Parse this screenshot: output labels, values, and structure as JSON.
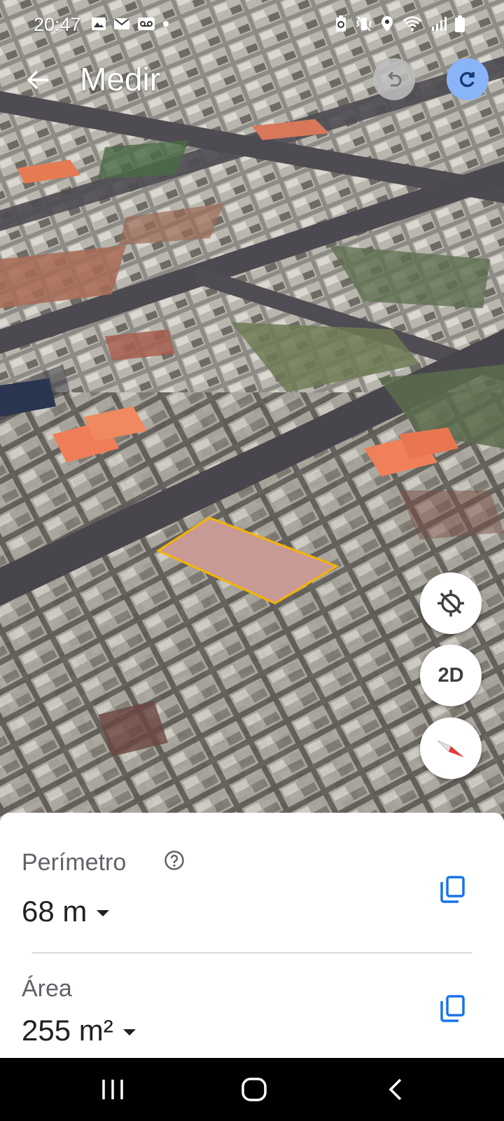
{
  "status_bar": {
    "time": "20:47",
    "left_icons": [
      "image-icon",
      "mail-icon",
      "voicemail-icon",
      "dot-icon"
    ],
    "right_icons": [
      "battery-saver-icon",
      "mute-vibrate-icon",
      "location-icon",
      "wifi-icon",
      "signal-icon",
      "battery-icon"
    ]
  },
  "header": {
    "title": "Medir",
    "back_icon": "arrow-left-icon",
    "undo_icon": "undo-icon",
    "redo_icon": "redo-icon"
  },
  "map_controls": {
    "location_icon": "location-disabled-icon",
    "view_mode_label": "2D",
    "compass_icon": "compass-icon"
  },
  "colors": {
    "accent": "#1a73e8",
    "redo_bg": "#8ab4f8",
    "polygon_outline": "#f5b400"
  },
  "measurements": {
    "perimeter": {
      "label": "Perímetro",
      "value": "68 m",
      "help_icon": "help-icon",
      "copy_icon": "copy-icon"
    },
    "area": {
      "label": "Área",
      "value": "255 m²",
      "copy_icon": "copy-icon"
    }
  },
  "nav_bar": {
    "icons": [
      "recents-icon",
      "home-icon",
      "back-icon"
    ]
  }
}
